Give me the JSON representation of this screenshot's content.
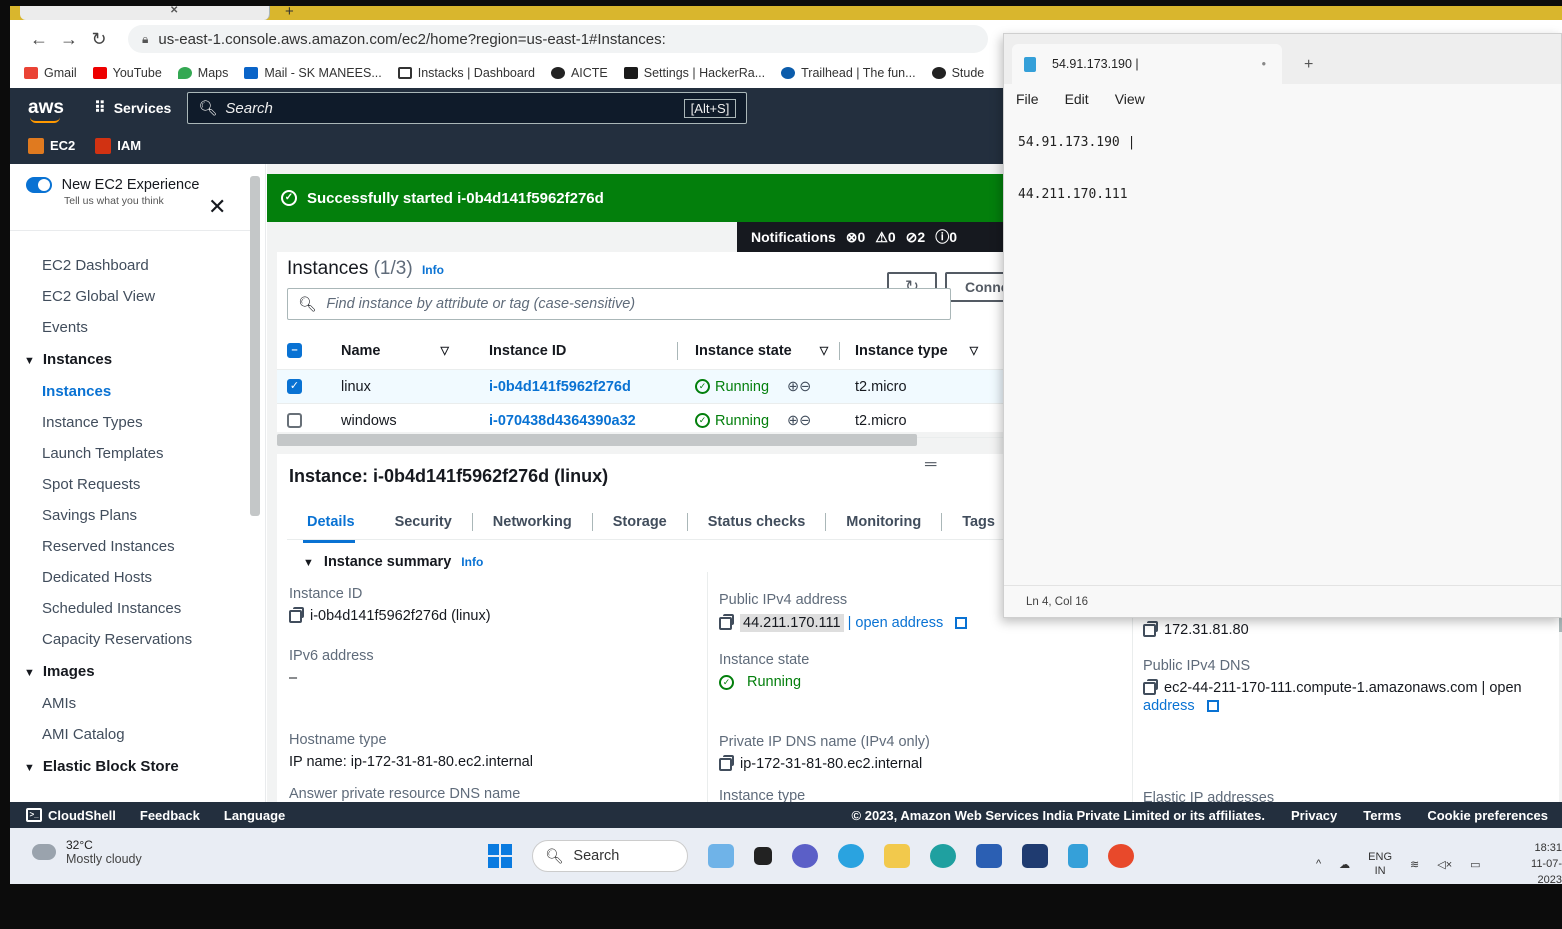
{
  "browser": {
    "url": "us-east-1.console.aws.amazon.com/ec2/home?region=us-east-1#Instances:",
    "bookmarks": [
      "Gmail",
      "YouTube",
      "Maps",
      "Mail - SK MANEES...",
      "Instacks | Dashboard",
      "AICTE",
      "Settings | HackerRa...",
      "Trailhead | The fun...",
      "Stude"
    ]
  },
  "aws": {
    "logo": "aws",
    "services_label": "Services",
    "search_placeholder": "Search",
    "search_shortcut": "[Alt+S]",
    "favorites": [
      "EC2",
      "IAM"
    ]
  },
  "sidebar": {
    "new_experience_title": "New EC2 Experience",
    "new_experience_sub": "Tell us what you think",
    "top_items": [
      "EC2 Dashboard",
      "EC2 Global View",
      "Events"
    ],
    "instances_section": "Instances",
    "instances_items": [
      "Instances",
      "Instance Types",
      "Launch Templates",
      "Spot Requests",
      "Savings Plans",
      "Reserved Instances",
      "Dedicated Hosts",
      "Scheduled Instances",
      "Capacity Reservations"
    ],
    "images_section": "Images",
    "images_items": [
      "AMIs",
      "AMI Catalog"
    ],
    "ebs_section": "Elastic Block Store"
  },
  "flash": {
    "message": "Successfully started i-0b4d141f5962f276d"
  },
  "notifications": {
    "label": "Notifications",
    "errors": "0",
    "warnings": "0",
    "success": "2",
    "info": "0"
  },
  "instances": {
    "title": "Instances",
    "count": "(1/3)",
    "info": "Info",
    "search_placeholder": "Find instance by attribute or tag (case-sensitive)",
    "connect_label": "Conne",
    "columns": [
      "Name",
      "Instance ID",
      "Instance state",
      "Instance type"
    ],
    "rows": [
      {
        "selected": true,
        "name": "linux",
        "id": "i-0b4d141f5962f276d",
        "state": "Running",
        "type": "t2.micro"
      },
      {
        "selected": false,
        "name": "windows",
        "id": "i-070438d4364390a32",
        "state": "Running",
        "type": "t2.micro"
      }
    ]
  },
  "detail": {
    "title": "Instance: i-0b4d141f5962f276d (linux)",
    "tabs": [
      "Details",
      "Security",
      "Networking",
      "Storage",
      "Status checks",
      "Monitoring",
      "Tags"
    ],
    "summary_label": "Instance summary",
    "summary_info": "Info",
    "instance_id_label": "Instance ID",
    "instance_id_value": "i-0b4d141f5962f276d (linux)",
    "ipv6_label": "IPv6 address",
    "ipv6_value": "–",
    "hostname_type_label": "Hostname type",
    "hostname_type_value": "IP name: ip-172-31-81-80.ec2.internal",
    "answer_dns_label": "Answer private resource DNS name",
    "public_ipv4_label": "Public IPv4 address",
    "public_ipv4_value": "44.211.170.111",
    "open_address": "| open address",
    "instance_state_label": "Instance state",
    "instance_state_value": "Running",
    "private_dns_label": "Private IP DNS name (IPv4 only)",
    "private_dns_value": "ip-172-31-81-80.ec2.internal",
    "instance_type_label": "Instance type",
    "private_ip_value": "172.31.81.80",
    "public_dns_label": "Public IPv4 DNS",
    "public_dns_value": "ec2-44-211-170-111.compute-1.amazonaws.com | open",
    "public_dns_value2": "address",
    "elastic_ip_label": "Elastic IP addresses"
  },
  "footer": {
    "cloudshell": "CloudShell",
    "feedback": "Feedback",
    "language": "Language",
    "copyright": "© 2023, Amazon Web Services India Private Limited or its affiliates.",
    "privacy": "Privacy",
    "terms": "Terms",
    "cookies": "Cookie preferences"
  },
  "notepad": {
    "tab_title": "54.91.173.190 |",
    "menu": [
      "File",
      "Edit",
      "View"
    ],
    "line1": "54.91.173.190 |",
    "line2": "44.211.170.111",
    "status": "Ln 4, Col 16"
  },
  "taskbar": {
    "temp": "32°C",
    "weather": "Mostly cloudy",
    "search": "Search",
    "lang1": "ENG",
    "lang2": "IN",
    "time": "18:31",
    "date": "11-07-2023"
  },
  "colors": {
    "aws_nav": "#232f3e",
    "aws_orange": "#ff9900",
    "success_green": "#037f0c",
    "link_blue": "#0972d3"
  }
}
